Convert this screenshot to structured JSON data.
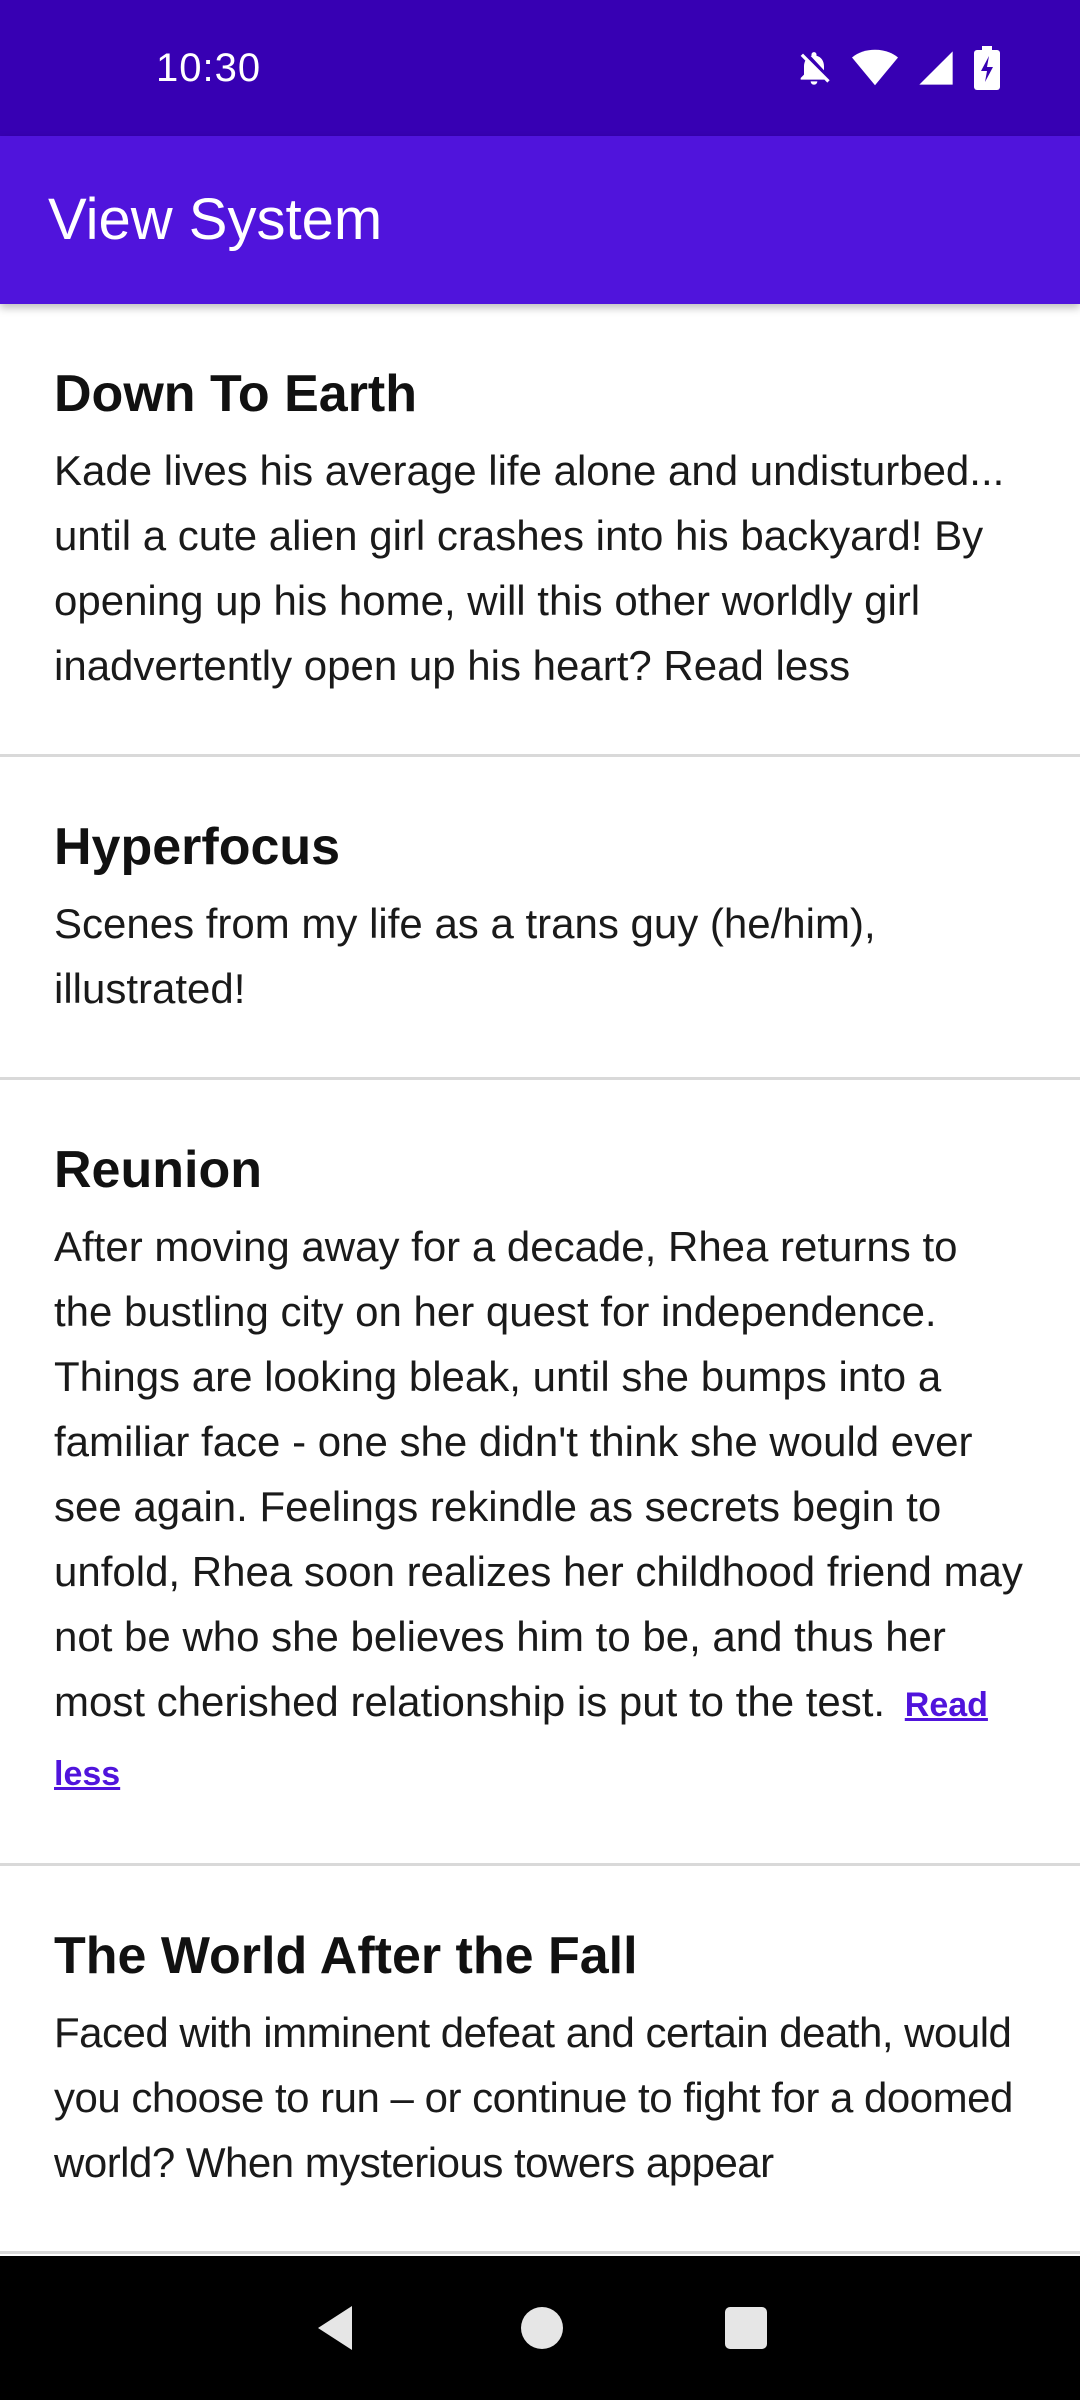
{
  "status_bar": {
    "time": "10:30",
    "icons": [
      "notifications-off-icon",
      "wifi-icon",
      "cell-signal-icon",
      "battery-charging-icon"
    ]
  },
  "app_bar": {
    "title": "View System",
    "color": "#5014DC",
    "status_color": "#3700B3"
  },
  "items": [
    {
      "title": "Down To Earth",
      "description": "Kade lives his average life alone and undisturbed... until a cute alien girl crashes into his backyard! By opening up his home, will this other worldly girl inadvertently open up his heart? Read less"
    },
    {
      "title": "Hyperfocus",
      "description": "Scenes from my life as a trans guy (he/him), illustrated!"
    },
    {
      "title": "Reunion",
      "description": "After moving away for a decade, Rhea returns to the bustling city on her quest for independence. Things are looking bleak, until she bumps into a familiar face - one she didn't think she would ever see again. Feelings rekindle as secrets begin to unfold, Rhea soon realizes her childhood friend may not be who she believes him to be, and thus her most cherished relationship is put to the test.",
      "read_less_label": "Read less"
    },
    {
      "title": "The World After the Fall",
      "description": "Faced with imminent defeat and certain death, would you choose to run – or continue to fight for a doomed world? When mysterious towers appear"
    }
  ],
  "nav_bar": {
    "icons": [
      "back-icon",
      "home-icon",
      "recents-icon"
    ]
  }
}
